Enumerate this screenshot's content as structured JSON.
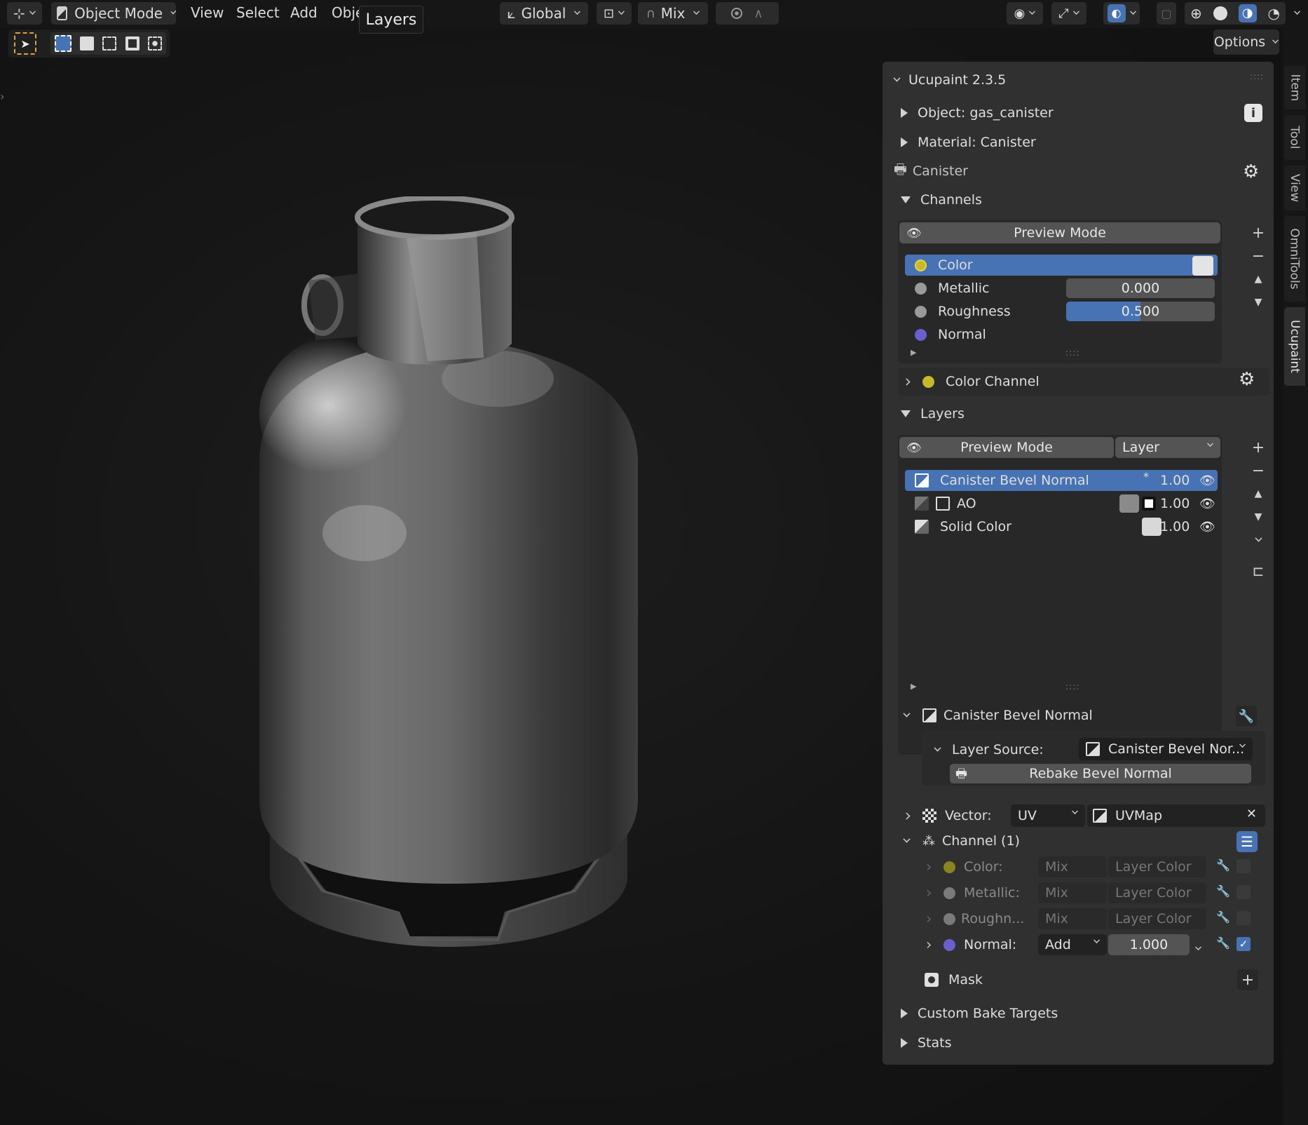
{
  "header": {
    "mode": "Object Mode",
    "menus": [
      "View",
      "Select",
      "Add",
      "Obje"
    ],
    "tooltip": "Layers",
    "transform_orientation": "Global",
    "pivot_icon": "pivot-icon",
    "snap_mix": "Mix",
    "options_label": "Options"
  },
  "sidebar_tabs": [
    "Item",
    "Tool",
    "View",
    "OmniTools",
    "Ucupaint"
  ],
  "panel": {
    "title": "Ucupaint 2.3.5",
    "object_label": "Object: gas_canister",
    "material_label": "Material: Canister",
    "node_label": "Canister",
    "channels_label": "Channels",
    "channels_preview": "Preview Mode",
    "channels": [
      {
        "name": "Color",
        "color": "#c8b82a",
        "value": "",
        "selected": true
      },
      {
        "name": "Metallic",
        "color": "#9a9a9a",
        "value": "0.000",
        "fill": 0
      },
      {
        "name": "Roughness",
        "color": "#9a9a9a",
        "value": "0.500",
        "fill": 0.5
      },
      {
        "name": "Normal",
        "color": "#6b5fd0",
        "value": ""
      }
    ],
    "color_channel_label": "Color Channel",
    "layers_label": "Layers",
    "layers_preview": "Preview Mode",
    "layers_mode": "Layer",
    "layers": [
      {
        "name": "Canister Bevel Normal",
        "value": "1.00",
        "selected": true,
        "star": "*"
      },
      {
        "name": "AO",
        "value": "1.00"
      },
      {
        "name": "Solid Color",
        "value": "1.00"
      }
    ],
    "layer_section_title": "Canister Bevel Normal",
    "layer_source_label": "Layer Source:",
    "layer_source_value": "Canister Bevel Nor...",
    "rebake_label": "Rebake Bevel Normal",
    "vector_label": "Vector:",
    "vector_type": "UV",
    "uv_map": "UVMap",
    "channel_group_label": "Channel (1)",
    "channel_rows": [
      {
        "name": "Color:",
        "blend": "Mix",
        "source": "Layer Color",
        "color": "#8a8420",
        "enabled": false
      },
      {
        "name": "Metallic:",
        "blend": "Mix",
        "source": "Layer Color",
        "color": "#7a7a7a",
        "enabled": false
      },
      {
        "name": "Roughn...",
        "blend": "Mix",
        "source": "Layer Color",
        "color": "#7a7a7a",
        "enabled": false
      },
      {
        "name": "Normal:",
        "blend": "Add",
        "source": "1.000",
        "color": "#6b5fd0",
        "enabled": true
      }
    ],
    "mask_label": "Mask",
    "custom_bake_label": "Custom Bake Targets",
    "stats_label": "Stats"
  },
  "colors": {
    "accent": "#4772b3",
    "panel_bg": "#303030",
    "field_bg": "#545454"
  }
}
